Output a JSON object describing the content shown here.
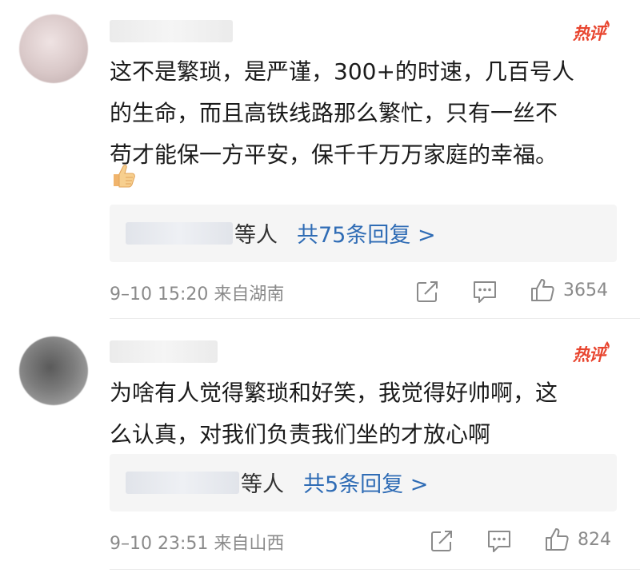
{
  "comments": [
    {
      "badge": "热评",
      "text_lines": [
        "这不是繁琐，是严谨，300+的时速，几百号人",
        "的生命，而且高铁线路那么繁忙，只有一丝不",
        "苟才能保一方平安，保千千万万家庭的幸福。"
      ],
      "emoji": "thumbs-up-emoji",
      "reply_others": "等人",
      "reply_link": "共75条回复 >",
      "meta": "9–10 15:20  来自湖南",
      "likes": "3654"
    },
    {
      "badge": "热评",
      "text_lines": [
        "为啥有人觉得繁琐和好笑，我觉得好帅啊，这",
        "么认真，对我们负责我们坐的才放心啊"
      ],
      "reply_others": "等人",
      "reply_link": "共5条回复 >",
      "meta": "9–10 23:51  来自山西",
      "likes": "824"
    }
  ],
  "colors": {
    "badge": "#e8452f",
    "link": "#2f6cb5",
    "meta": "#8a8a8a",
    "reply_bg": "#f5f5f5"
  },
  "icons": [
    "share-icon",
    "comment-icon",
    "like-icon"
  ]
}
